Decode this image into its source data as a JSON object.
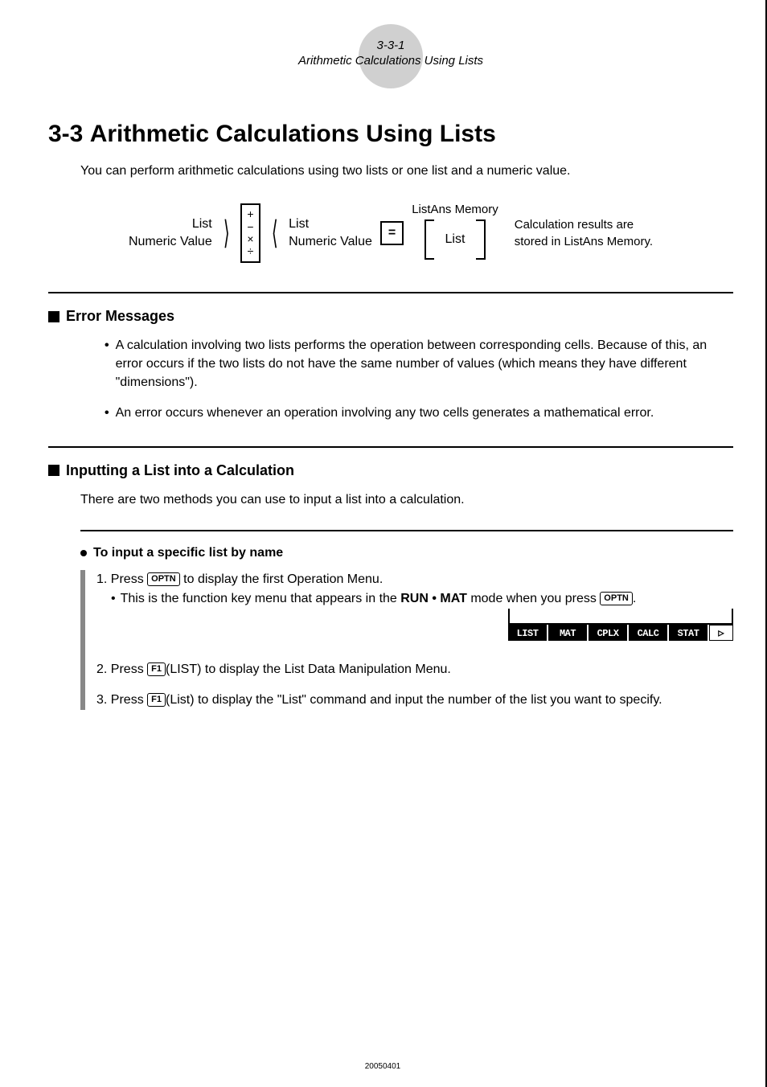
{
  "header": {
    "page_num": "3-3-1",
    "running_title": "Arithmetic Calculations Using Lists"
  },
  "chapter": {
    "number": "3-3",
    "title": "Arithmetic Calculations Using Lists",
    "intro": "You can perform arithmetic calculations using two lists or one list and a numeric value."
  },
  "diagram": {
    "left_top": "List",
    "left_bottom": "Numeric Value",
    "ops": "+\n−\n×\n÷",
    "right_top": "List",
    "right_bottom": "Numeric Value",
    "equals": "=",
    "listans_label": "ListAns Memory",
    "listans_content": "List",
    "result_note_1": "Calculation results are",
    "result_note_2": "stored in ListAns Memory."
  },
  "section1": {
    "title": "Error Messages",
    "bullets": [
      "A calculation involving two lists performs the operation between corresponding cells. Because of this, an error occurs if the two lists do not have the same number of values (which means they have different \"dimensions\").",
      "An error occurs whenever an operation involving any two cells generates a mathematical error."
    ]
  },
  "section2": {
    "title": "Inputting a List into a Calculation",
    "desc": "There are two methods you can use to input a list into a calculation."
  },
  "subsection": {
    "title": "To input a specific list by name",
    "step1_a": "1. Press ",
    "step1_key": "OPTN",
    "step1_b": " to display the first Operation Menu.",
    "step1_sub_a": "This is the function key menu that appears in the ",
    "step1_sub_mode": "RUN • MAT",
    "step1_sub_b": " mode  when you press ",
    "step1_sub_key": "OPTN",
    "step1_sub_c": ".",
    "menu": [
      "LIST",
      "MAT",
      "CPLX",
      "CALC",
      "STAT"
    ],
    "menu_arrow": "▷",
    "step2_a": "2. Press ",
    "step2_key": "F1",
    "step2_b": "(LIST) to display the List Data Manipulation Menu.",
    "step3_a": "3. Press ",
    "step3_key": "F1",
    "step3_b": "(List) to display the \"List\" command and input the number of the list you want to specify."
  },
  "footer": {
    "code": "20050401"
  }
}
